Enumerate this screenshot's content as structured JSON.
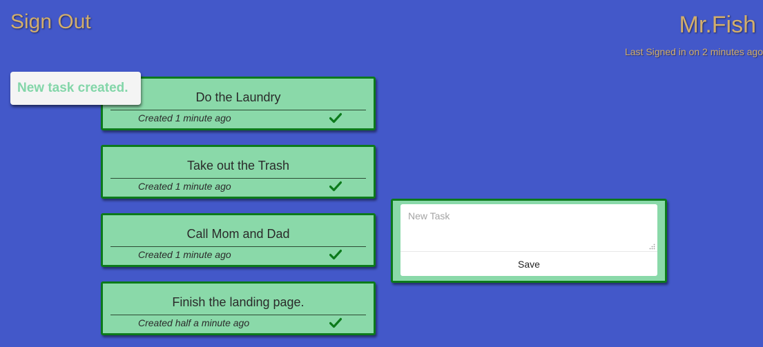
{
  "header": {
    "sign_out_label": "Sign Out",
    "username": "Mr.Fish",
    "last_signed": "Last Signed in on 2 minutes ago"
  },
  "toast": {
    "message": "New task created."
  },
  "tasks": [
    {
      "title": "Do the Laundry",
      "created": "Created 1 minute ago"
    },
    {
      "title": "Take out the Trash",
      "created": "Created 1 minute ago"
    },
    {
      "title": "Call Mom and Dad",
      "created": "Created 1 minute ago"
    },
    {
      "title": "Finish the landing page.",
      "created": "Created half a minute ago"
    }
  ],
  "new_task": {
    "placeholder": "New Task",
    "value": "",
    "save_label": "Save"
  },
  "icons": {
    "task_complete": "check-icon",
    "textarea_resize": "resize-grip-icon"
  },
  "colors": {
    "background": "#4358c9",
    "gold_text": "#d2ae6d",
    "card_fill": "#8ad9a9",
    "card_border": "#0c7a1b",
    "check": "#0c7a1b",
    "toast_text": "#83d6a9"
  }
}
